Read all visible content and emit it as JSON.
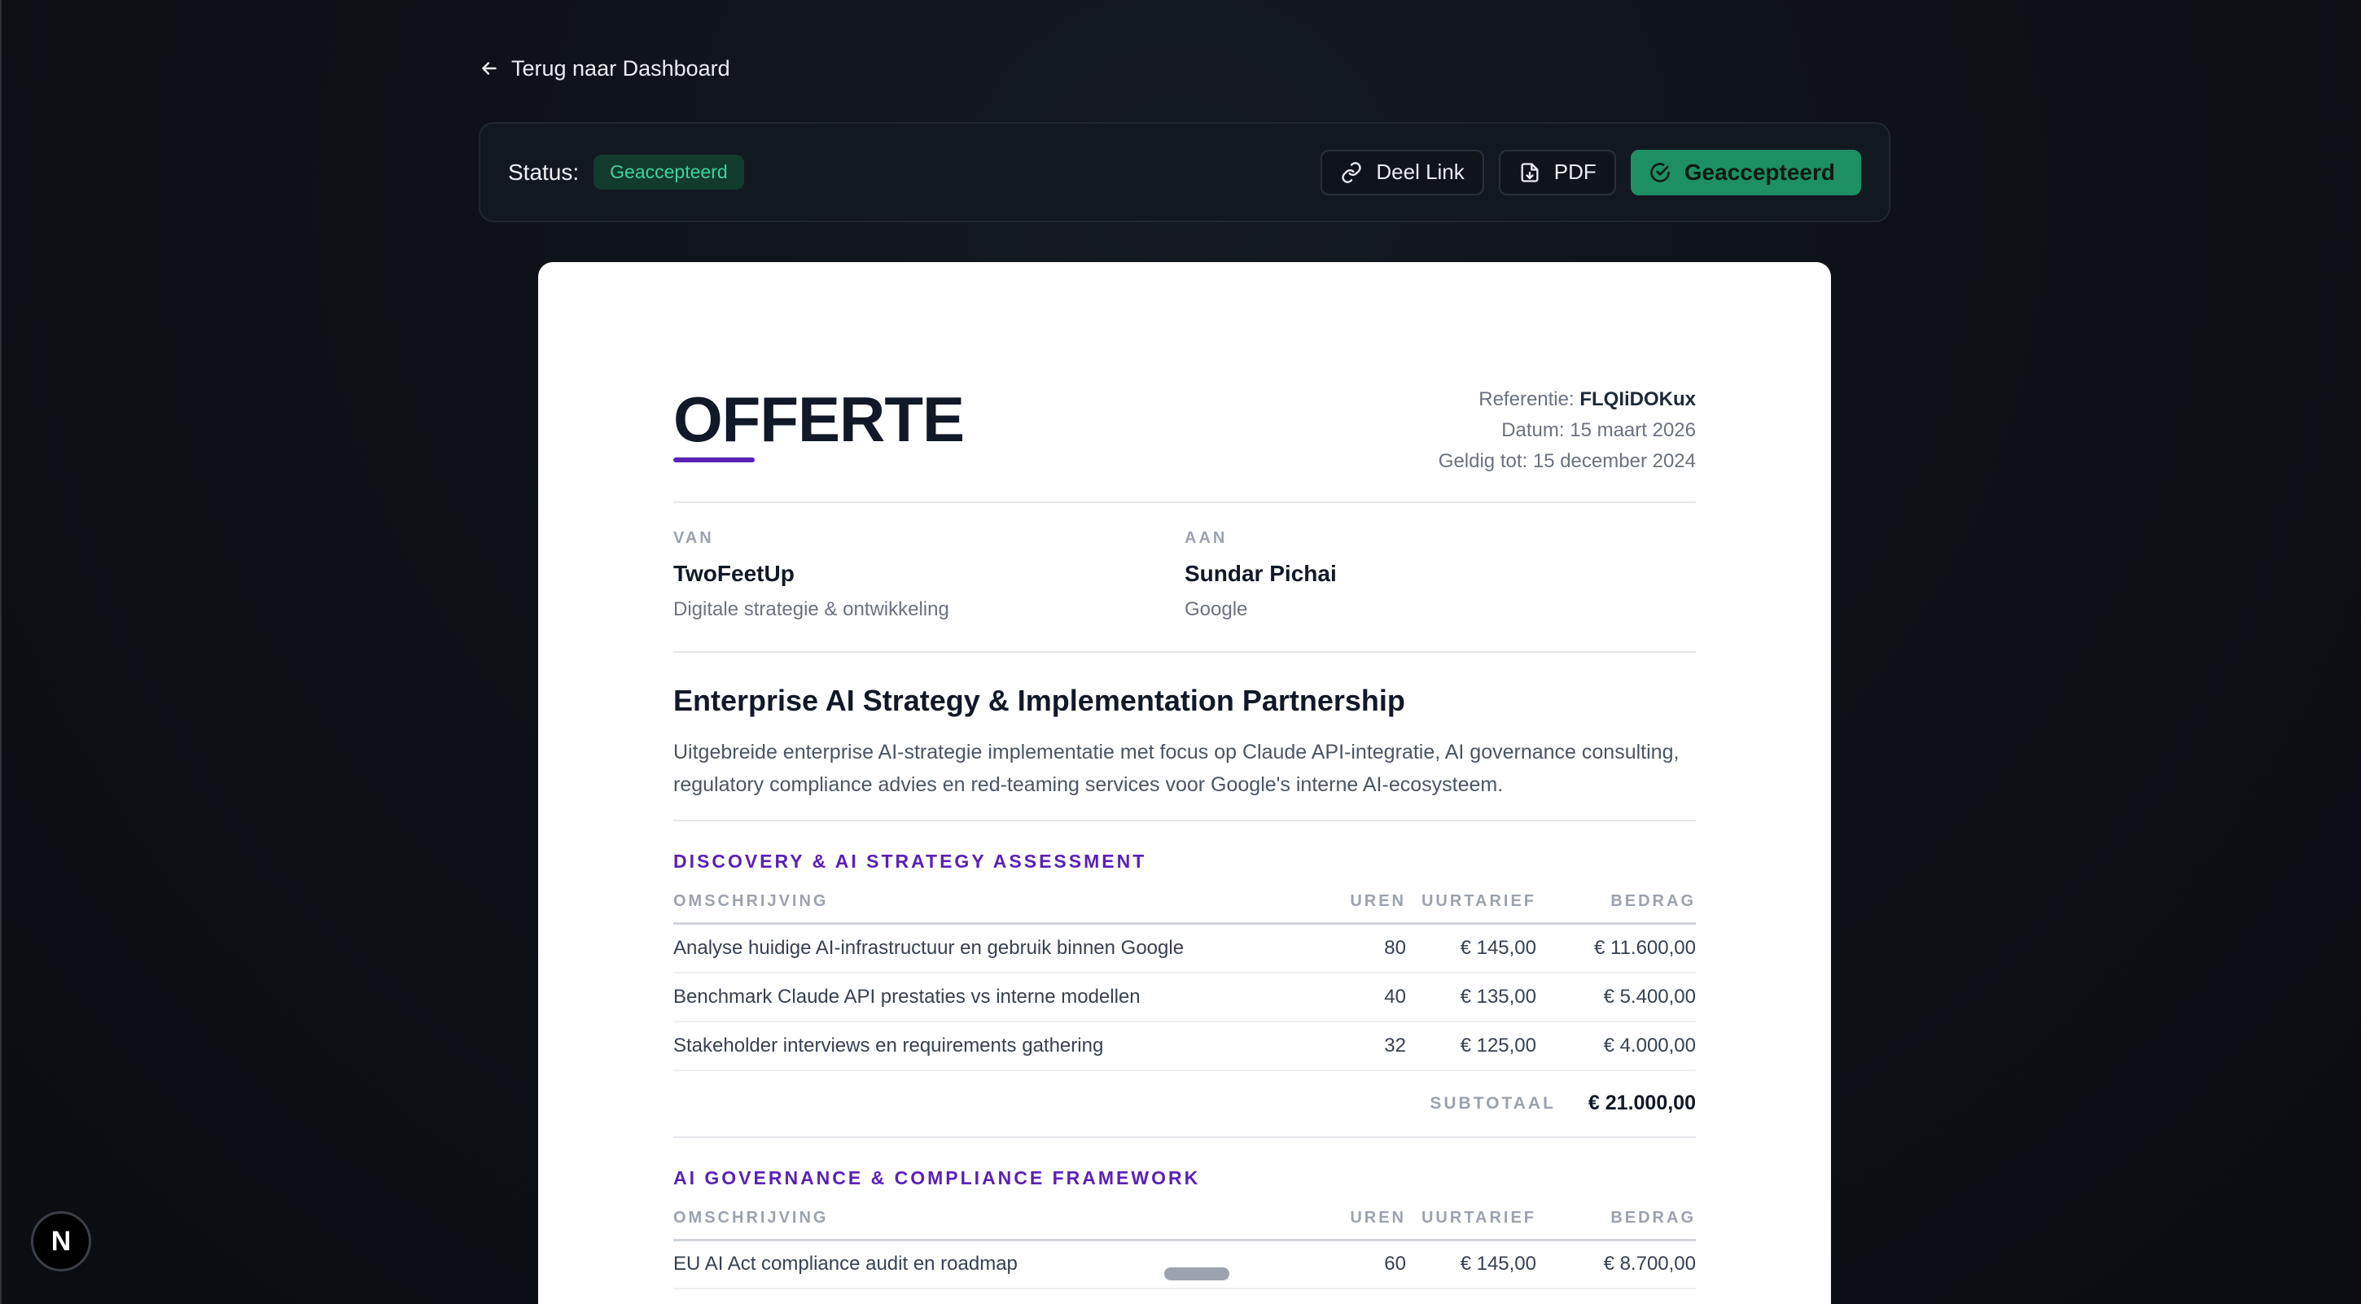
{
  "nav": {
    "back_label": "Terug naar Dashboard"
  },
  "toolbar": {
    "status_label": "Status:",
    "status_value": "Geaccepteerd",
    "share_label": "Deel Link",
    "pdf_label": "PDF",
    "accepted_label": "Geaccepteerd"
  },
  "quote": {
    "title": "OFFERTE",
    "reference_label": "Referentie:",
    "reference_value": "FLQIiDOKux",
    "date": "Datum: 15 maart 2026",
    "valid_until": "Geldig tot: 15 december 2024",
    "from": {
      "label": "VAN",
      "name": "TwoFeetUp",
      "sub": "Digitale strategie & ontwikkeling"
    },
    "to": {
      "label": "AAN",
      "name": "Sundar Pichai",
      "sub": "Google"
    },
    "project_title": "Enterprise AI Strategy & Implementation Partnership",
    "project_desc": "Uitgebreide enterprise AI-strategie implementatie met focus op Claude API-integratie, AI governance consulting, regulatory compliance advies en red-teaming services voor Google's interne AI-ecosysteem.",
    "columns": {
      "desc": "OMSCHRIJVING",
      "hours": "UREN",
      "rate": "UURTARIEF",
      "amount": "BEDRAG"
    },
    "sections": [
      {
        "title": "DISCOVERY & AI STRATEGY ASSESSMENT",
        "rows": [
          {
            "desc": "Analyse huidige AI-infrastructuur en gebruik binnen Google",
            "hours": "80",
            "rate": "€ 145,00",
            "amount": "€ 11.600,00"
          },
          {
            "desc": "Benchmark Claude API prestaties vs interne modellen",
            "hours": "40",
            "rate": "€ 135,00",
            "amount": "€ 5.400,00"
          },
          {
            "desc": "Stakeholder interviews en requirements gathering",
            "hours": "32",
            "rate": "€ 125,00",
            "amount": "€ 4.000,00"
          }
        ],
        "subtotal_label": "SUBTOTAAL",
        "subtotal_value": "€ 21.000,00"
      },
      {
        "title": "AI GOVERNANCE & COMPLIANCE FRAMEWORK",
        "rows": [
          {
            "desc": "EU AI Act compliance audit en roadmap",
            "hours": "60",
            "rate": "€ 145,00",
            "amount": "€ 8.700,00"
          }
        ]
      }
    ]
  },
  "dev_badge": {
    "label": "N"
  },
  "colors": {
    "accent": "#5b21b6",
    "success": "#1e8f63",
    "background": "#0c0f15"
  }
}
